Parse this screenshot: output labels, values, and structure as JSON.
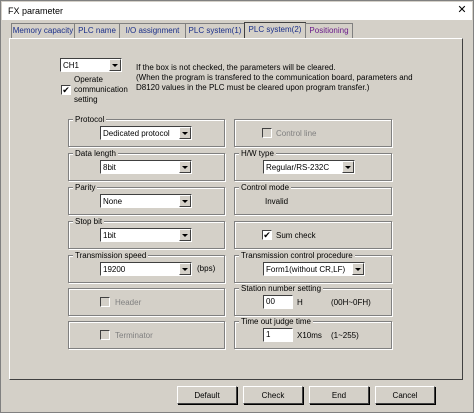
{
  "window": {
    "title": "FX parameter",
    "close_glyph": "✕"
  },
  "tabs": [
    {
      "label": "Memory capacity"
    },
    {
      "label": "PLC name"
    },
    {
      "label": "I/O assignment"
    },
    {
      "label": "PLC system(1)"
    },
    {
      "label": "PLC system(2)"
    },
    {
      "label": "Positioning"
    }
  ],
  "channel": {
    "value": "CH1"
  },
  "operate_comm": {
    "label_line1": "Operate",
    "label_line2": "communication",
    "label_line3": "setting",
    "checked": "✔"
  },
  "notice": {
    "line1": "If the box is not checked, the parameters will be cleared.",
    "line2": "(When the program is transfered to the communication board, parameters and",
    "line3": "D8120 values in the PLC must be cleared upon program transfer.)"
  },
  "protocol": {
    "label": "Protocol",
    "value": "Dedicated protocol"
  },
  "data_length": {
    "label": "Data length",
    "value": "8bit"
  },
  "parity": {
    "label": "Parity",
    "value": "None"
  },
  "stop_bit": {
    "label": "Stop bit",
    "value": "1bit"
  },
  "transmission_speed": {
    "label": "Transmission speed",
    "value": "19200",
    "unit": "(bps)"
  },
  "header": {
    "label": "Header"
  },
  "terminator": {
    "label": "Terminator"
  },
  "control_line": {
    "label": "Control line"
  },
  "hw_type": {
    "label": "H/W type",
    "value": "Regular/RS-232C"
  },
  "control_mode": {
    "label": "Control mode",
    "value": "Invalid"
  },
  "sum_check": {
    "label": "Sum check",
    "checked": "✔"
  },
  "transmission_control": {
    "label": "Transmission control procedure",
    "value": "Form1(without CR,LF)"
  },
  "station_number": {
    "label": "Station number setting",
    "value": "00",
    "unit": "H",
    "range": "(00H~0FH)"
  },
  "timeout": {
    "label": "Time out judge time",
    "value": "1",
    "unit": "X10ms",
    "range": "(1~255)"
  },
  "buttons": {
    "default": "Default",
    "check": "Check",
    "end": "End",
    "cancel": "Cancel"
  }
}
